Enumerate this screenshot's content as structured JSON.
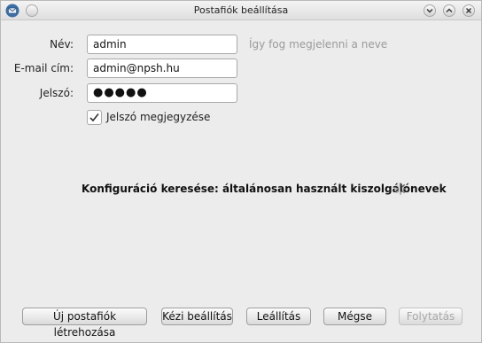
{
  "window": {
    "title": "Postafiók beállítása",
    "app_icon": "thunderbird-icon",
    "controls": [
      "minimize-icon",
      "maximize-icon",
      "close-icon"
    ]
  },
  "form": {
    "name_label": "Név:",
    "name_value": "admin",
    "name_hint": "Így fog megjelenni a neve",
    "email_label": "E-mail cím:",
    "email_value": "admin@npsh.hu",
    "password_label": "Jelszó:",
    "password_masked": "●●●●●",
    "remember_password_label": "Jelszó megjegyzése",
    "remember_password_checked": true
  },
  "status": {
    "text": "Konfiguráció keresése: általánosan használt kiszolgálónevek"
  },
  "buttons": {
    "new_account": "Új postafiók létrehozása",
    "manual_setup": "Kézi beállítás",
    "stop": "Leállítás",
    "cancel": "Mégse",
    "continue": "Folytatás"
  }
}
